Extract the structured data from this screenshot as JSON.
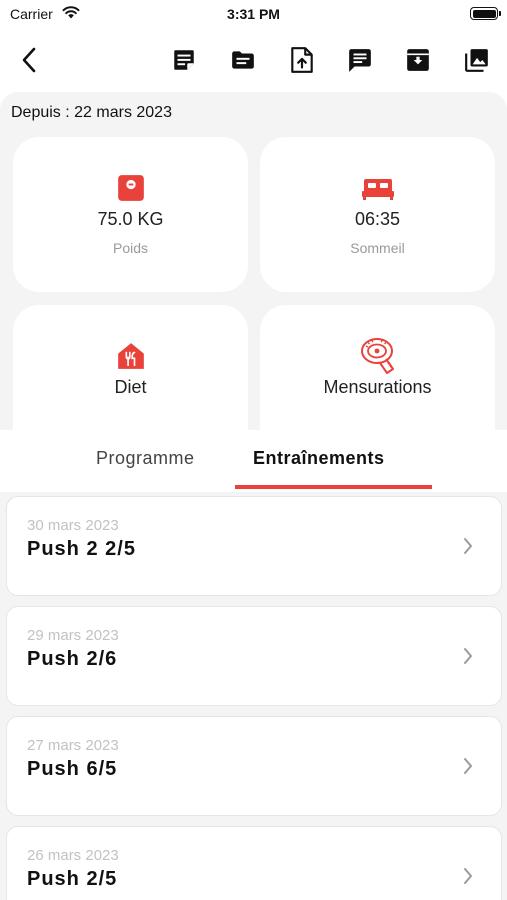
{
  "status_bar": {
    "carrier": "Carrier",
    "time": "3:31 PM"
  },
  "toolbar": {
    "icons": [
      "back-chevron-icon",
      "note-icon",
      "folder-icon",
      "file-upload-icon",
      "message-icon",
      "archive-icon",
      "photo-library-icon"
    ]
  },
  "header": {
    "since": "Depuis : 22 mars 2023"
  },
  "stats": {
    "weight": {
      "value": "75.0 KG",
      "label": "Poids",
      "icon": "scale-icon"
    },
    "sleep": {
      "value": "06:35",
      "label": "Sommeil",
      "icon": "bed-icon"
    },
    "diet": {
      "label": "Diet",
      "icon": "restaurant-icon"
    },
    "measurements": {
      "label": "Mensurations",
      "icon": "tape-measure-icon"
    }
  },
  "tabs": {
    "programme": "Programme",
    "workouts": "Entraînements",
    "active": "workouts"
  },
  "workouts": [
    {
      "date": "30 mars 2023",
      "title": "Push 2 2/5"
    },
    {
      "date": "29 mars 2023",
      "title": "Push 2/6"
    },
    {
      "date": "27 mars 2023",
      "title": "Push 6/5"
    },
    {
      "date": "26 mars 2023",
      "title": "Push 2/5"
    }
  ],
  "colors": {
    "accent": "#e8423a",
    "background": "#f4f4f4",
    "card": "#ffffff"
  }
}
